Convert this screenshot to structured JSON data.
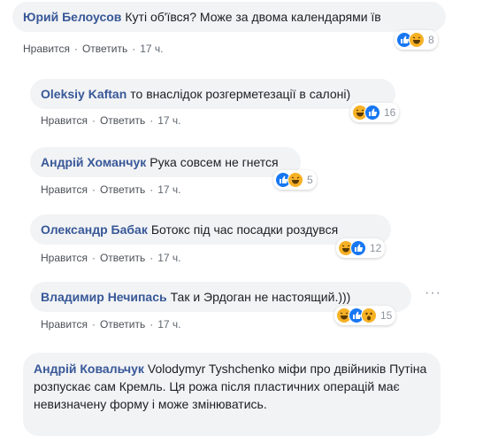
{
  "actions": {
    "like_label": "Нравится",
    "reply_label": "Ответить"
  },
  "comments": [
    {
      "author": "Юрий Белоусов",
      "text": "Куті об'ївся? Може за двома календарями їв",
      "time": "17 ч.",
      "reactions": [
        "like-icon",
        "haha-icon"
      ],
      "count": "8"
    },
    {
      "author": "Oleksiy Kaftan",
      "text": "то внаслідок розгерметезації в салоні)",
      "time": "17 ч.",
      "reactions": [
        "haha-icon",
        "like-icon"
      ],
      "count": "16"
    },
    {
      "author": "Андрій Хоманчук",
      "text": "Рука совсем не гнется",
      "time": "17 ч.",
      "reactions": [
        "like-icon",
        "haha-icon"
      ],
      "count": "5"
    },
    {
      "author": "Олександр Бабак",
      "text": "Ботокс під час посадки роздувся",
      "time": "17 ч.",
      "reactions": [
        "haha-icon",
        "like-icon"
      ],
      "count": "12"
    },
    {
      "author": "Владимир Нечипась",
      "text": "Так и Эрдоган не настоящий.)))",
      "time": "17 ч.",
      "reactions": [
        "haha-icon",
        "like-icon",
        "wow-icon"
      ],
      "count": "15"
    },
    {
      "author": "Андрій Ковальчук",
      "text": "Volodymyr Tyshchenko міфи про двійників Путіна розпускає сам Кремль. Ця рожа після пластичних операцій має невизначену форму і може змінюватись."
    }
  ],
  "colors": {
    "author": "#385898",
    "bubble": "#f2f3f5",
    "like": "#1877f2",
    "haha": "#f7b125"
  }
}
